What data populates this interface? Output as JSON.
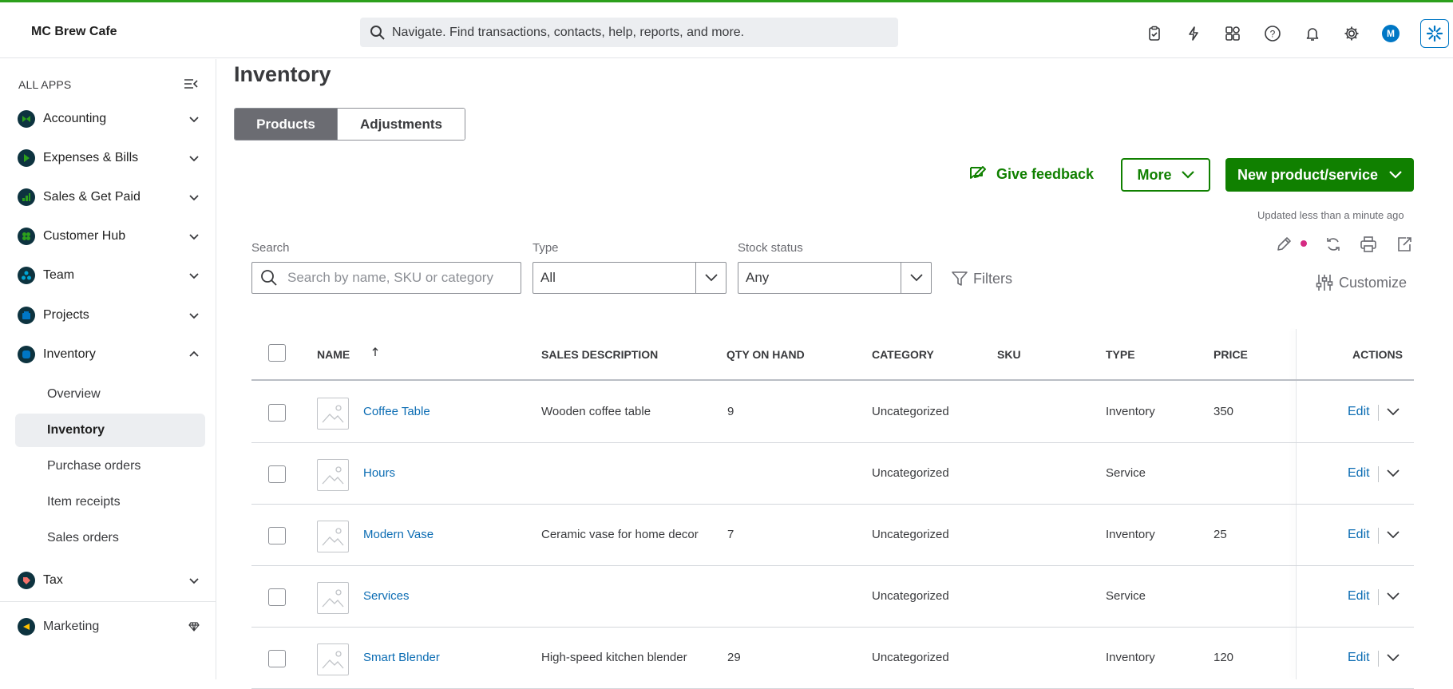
{
  "header": {
    "company": "MC Brew Cafe",
    "search_placeholder": "Navigate. Find transactions, contacts, help, reports, and more.",
    "avatar_initial": "M",
    "icons": [
      "tasks-icon",
      "lightning-icon",
      "apps-icon",
      "help-icon",
      "bell-icon",
      "gear-icon",
      "avatar",
      "assistant-icon"
    ]
  },
  "sidebar": {
    "all_apps": "ALL APPS",
    "items": [
      {
        "label": "Accounting",
        "color": "#2ca01c"
      },
      {
        "label": "Expenses & Bills",
        "color": "#2ca01c"
      },
      {
        "label": "Sales & Get Paid",
        "color": "#2ca01c"
      },
      {
        "label": "Customer Hub",
        "color": "#2ca01c"
      },
      {
        "label": "Team",
        "color": "#00a6d6"
      },
      {
        "label": "Projects",
        "color": "#0077c5"
      },
      {
        "label": "Inventory",
        "color": "#0077c5"
      },
      {
        "label": "Tax",
        "color": "#f4716a"
      },
      {
        "label": "Marketing",
        "color": "#ffc100"
      }
    ],
    "inventory_sub": [
      "Overview",
      "Inventory",
      "Purchase orders",
      "Item receipts",
      "Sales orders"
    ]
  },
  "page": {
    "title": "Inventory",
    "tabs": [
      "Products",
      "Adjustments"
    ],
    "give_feedback": "Give feedback",
    "more": "More",
    "new_product": "New product/service",
    "updated": "Updated less than a minute ago",
    "filters": {
      "search_label": "Search",
      "search_placeholder": "Search by name, SKU or category",
      "type_label": "Type",
      "type_value": "All",
      "stock_label": "Stock status",
      "stock_value": "Any",
      "filters_btn": "Filters",
      "customize": "Customize"
    }
  },
  "table": {
    "headers": [
      "NAME",
      "SALES DESCRIPTION",
      "QTY ON HAND",
      "CATEGORY",
      "SKU",
      "TYPE",
      "PRICE",
      "ACTIONS"
    ],
    "rows": [
      {
        "name": "Coffee Table",
        "desc": "Wooden coffee table",
        "qty": "9",
        "category": "Uncategorized",
        "sku": "",
        "type": "Inventory",
        "price": "350",
        "action": "Edit"
      },
      {
        "name": "Hours",
        "desc": "",
        "qty": "",
        "category": "Uncategorized",
        "sku": "",
        "type": "Service",
        "price": "",
        "action": "Edit"
      },
      {
        "name": "Modern Vase",
        "desc": "Ceramic vase for home decor",
        "qty": "7",
        "category": "Uncategorized",
        "sku": "",
        "type": "Inventory",
        "price": "25",
        "action": "Edit"
      },
      {
        "name": "Services",
        "desc": "",
        "qty": "",
        "category": "Uncategorized",
        "sku": "",
        "type": "Service",
        "price": "",
        "action": "Edit"
      },
      {
        "name": "Smart Blender",
        "desc": "High-speed kitchen blender",
        "qty": "29",
        "category": "Uncategorized",
        "sku": "",
        "type": "Inventory",
        "price": "120",
        "action": "Edit"
      }
    ]
  },
  "colors": {
    "brand_green": "#108000",
    "link_blue": "#0b6cb3",
    "accent_pink": "#d52b83"
  }
}
